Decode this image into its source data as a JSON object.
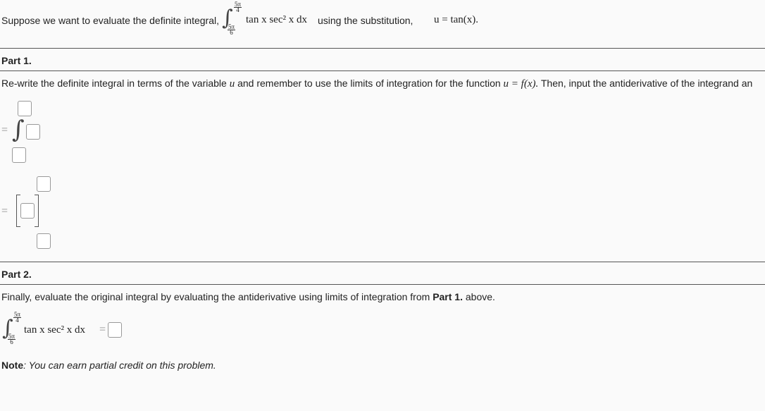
{
  "intro": {
    "text_before": "Suppose we want to evaluate the definite integral,",
    "integrand": "tan x sec² x dx",
    "text_middle": "using the substitution,",
    "substitution": "u = tan(x).",
    "upper_num": "5π",
    "upper_den": "4",
    "lower_num": "5π",
    "lower_den": "6"
  },
  "part1": {
    "heading": "Part 1.",
    "instruction_before": "Re-write the definite integral in terms of the variable",
    "instruction_var": "u",
    "instruction_middle": "and remember to use the limits of integration for the function",
    "instruction_func": "u = f(x).",
    "instruction_after": "Then, input the antiderivative of the integrand an",
    "eq_sign": "="
  },
  "part2": {
    "heading": "Part 2.",
    "instruction_before": "Finally, evaluate the original integral by evaluating the antiderivative using limits of integration from",
    "instruction_bold": "Part 1.",
    "instruction_after": "above.",
    "integrand": "tan x sec² x dx",
    "eq_sign": "="
  },
  "note": {
    "label": "Note",
    "text": ": You can earn partial credit on this problem."
  }
}
